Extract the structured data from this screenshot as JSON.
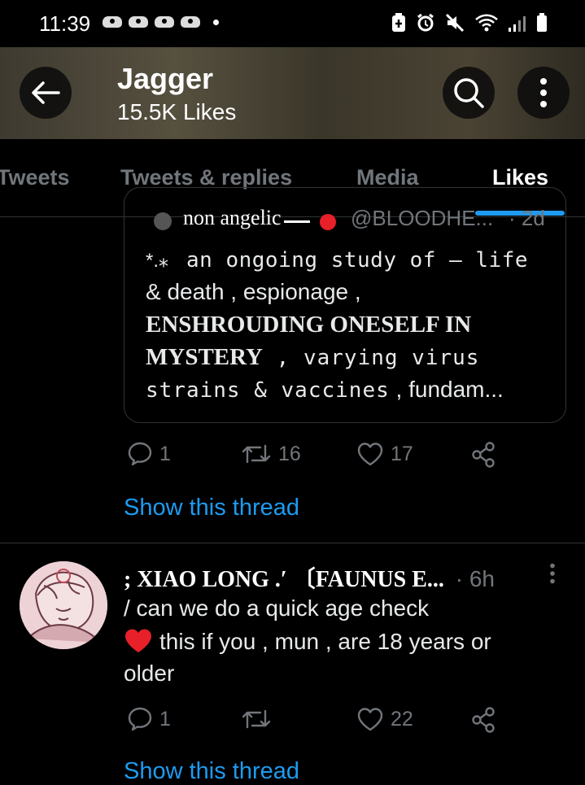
{
  "status_bar": {
    "time": "11:39"
  },
  "header": {
    "title": "Jagger",
    "subtitle": "15.5K Likes"
  },
  "tabs": [
    {
      "label": "Tweets"
    },
    {
      "label": "Tweets & replies"
    },
    {
      "label": "Media"
    },
    {
      "label": "Likes",
      "active": true
    }
  ],
  "quoted_tweet": {
    "author": "non angelic",
    "handle": "@BLOODHE...",
    "time": "· 2d",
    "lines": [
      {
        "prefix": "*.⁎",
        "text": "an ongoing study of  —  life"
      },
      {
        "text": "& death ,  espionage ,"
      },
      {
        "text": "ENSHROUDING ONESELF IN"
      },
      {
        "bold": "MYSTERY",
        "text": " , varying virus"
      },
      {
        "mono": "strains & vaccines",
        "text": " ,  fundam..."
      }
    ]
  },
  "tweet1_actions": {
    "replies": "1",
    "retweets": "16",
    "likes": "17"
  },
  "show_thread": "Show this thread",
  "tweet2": {
    "name": "; XIAO LONG .′ 〔FAUNUS E...",
    "time": "· 6h",
    "lines": [
      "/ can we do a quick age check",
      "this if you , mun , are 18 years or",
      "older"
    ],
    "actions": {
      "replies": "1",
      "retweets": "",
      "likes": "22"
    }
  },
  "show_thread_2": "Show this thread",
  "colors": {
    "accent": "#1d9bf0",
    "heart": "#e8202a",
    "muted": "#71767b"
  }
}
